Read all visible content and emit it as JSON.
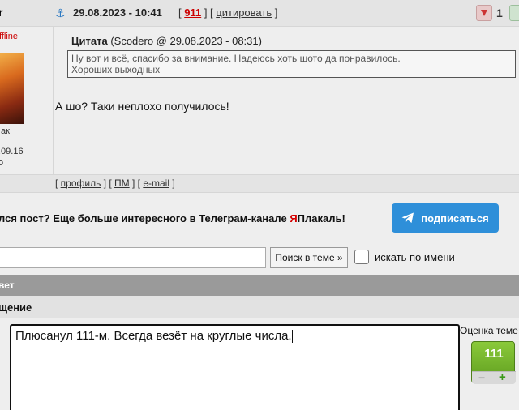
{
  "post": {
    "author_fragment": "r",
    "status": "ffline",
    "rank_fragment": "ıак",
    "reg_date_fragment": ".09.16",
    "reg_mark": "о",
    "date": "29.08.2023 - 10:41",
    "post_number": "911",
    "quote_link": "цитировать",
    "rating_count": "1",
    "quote_heading": "Цитата",
    "quote_meta": "(Scodero @ 29.08.2023 - 08:31)",
    "quote_line1": "Ну вот и всё, спасибо за внимание. Надеюсь хоть шото да понравилось.",
    "quote_line2": "Хороших выходных",
    "body": "А шо? Таки неплохо получилось!",
    "footer": {
      "profile": "профиль",
      "pm": "ПМ",
      "email": "e-mail"
    }
  },
  "promo": {
    "text_before": "лся пост? Еще больше интересного в Телеграм-канале ",
    "brand_ya": "Я",
    "brand_rest": "Плакаль!",
    "subscribe_label": "подписаться"
  },
  "search": {
    "input_value": "",
    "button_label": "Поиск в теме »",
    "checkbox_label": "искать по имени"
  },
  "reply": {
    "header": "вет",
    "message_label": "щение",
    "textarea_value": "Плюсанул 111-м. Всегда везёт на круглые числа.",
    "rating_label": "Оценка теме",
    "rating_value": "111",
    "rating_minus": "−",
    "rating_plus": "+"
  },
  "colors": {
    "accent_blue": "#2e8fd9",
    "brand_red": "#d40000",
    "rating_green": "#6fae2a"
  }
}
